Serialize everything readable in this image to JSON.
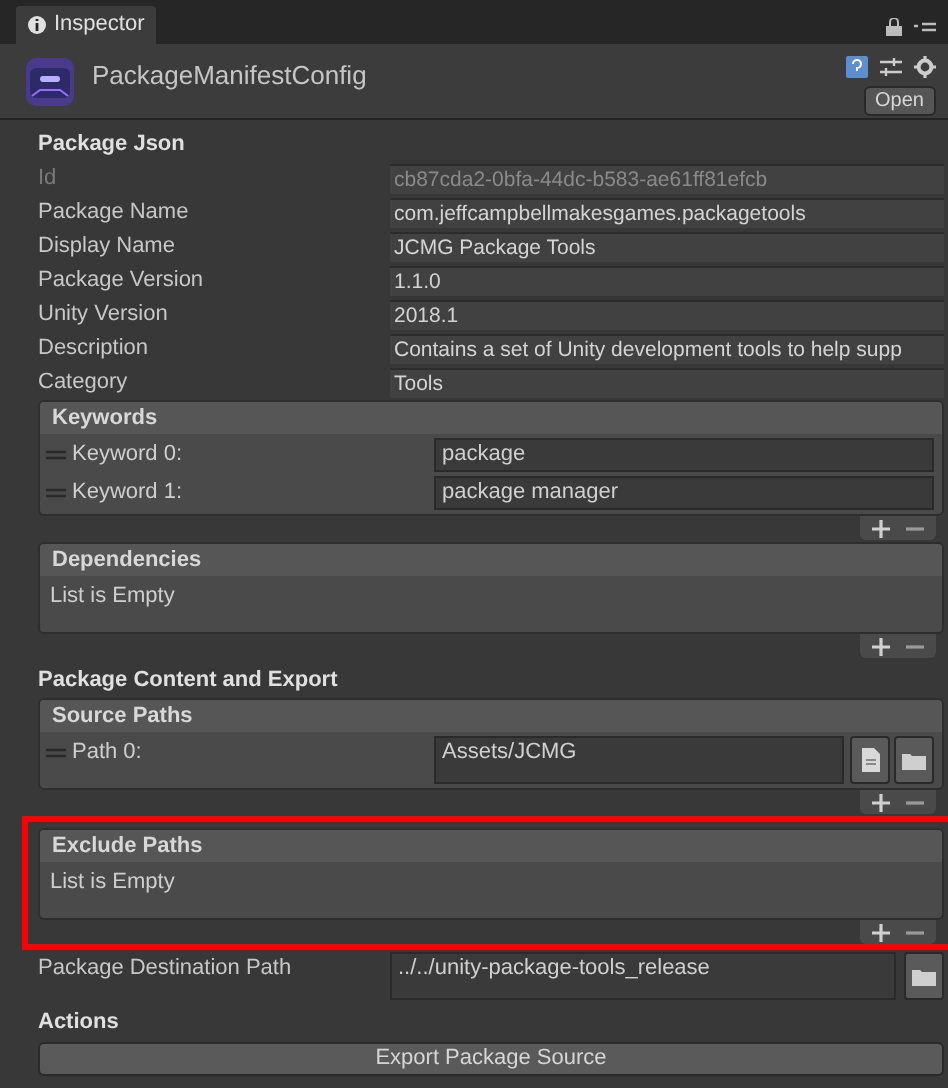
{
  "tab": {
    "label": "Inspector"
  },
  "header": {
    "title": "PackageManifestConfig",
    "open_button": "Open"
  },
  "blocks": [
    {
      "kind": "heading",
      "text": "Package Json"
    },
    {
      "kind": "field",
      "label": "Id",
      "value": "cb87cda2-0bfa-44dc-b583-ae61ff81efcb",
      "disabled": true
    },
    {
      "kind": "field",
      "label": "Package Name",
      "value": "com.jeffcampbellmakesgames.packagetools",
      "disabled": false
    },
    {
      "kind": "field",
      "label": "Display Name",
      "value": "JCMG Package Tools",
      "disabled": false
    },
    {
      "kind": "field",
      "label": "Package Version",
      "value": "1.1.0",
      "disabled": false
    },
    {
      "kind": "field",
      "label": "Unity Version",
      "value": "2018.1",
      "disabled": false
    },
    {
      "kind": "field",
      "label": "Description",
      "value": "Contains a set of Unity development tools to help supp",
      "disabled": false
    },
    {
      "kind": "field",
      "label": "Category",
      "value": "Tools",
      "disabled": false
    },
    {
      "kind": "list",
      "title": "Keywords",
      "highlighted": false,
      "items": [
        {
          "label": "Keyword 0:",
          "value": "package"
        },
        {
          "label": "Keyword 1:",
          "value": "package manager"
        }
      ]
    },
    {
      "kind": "list",
      "title": "Dependencies",
      "highlighted": false,
      "empty_text": "List is Empty"
    },
    {
      "kind": "heading",
      "text": "Package Content and Export"
    },
    {
      "kind": "list",
      "title": "Source Paths",
      "highlighted": false,
      "browse_buttons": true,
      "items": [
        {
          "label": "Path 0:",
          "value": "Assets/JCMG"
        }
      ]
    },
    {
      "kind": "list",
      "title": "Exclude Paths",
      "highlighted": true,
      "empty_text": "List is Empty"
    },
    {
      "kind": "path_field",
      "label": "Package Destination Path",
      "value": "../../unity-package-tools_release"
    },
    {
      "kind": "heading",
      "text": "Actions"
    },
    {
      "kind": "button",
      "label": "Export Package Source"
    }
  ]
}
